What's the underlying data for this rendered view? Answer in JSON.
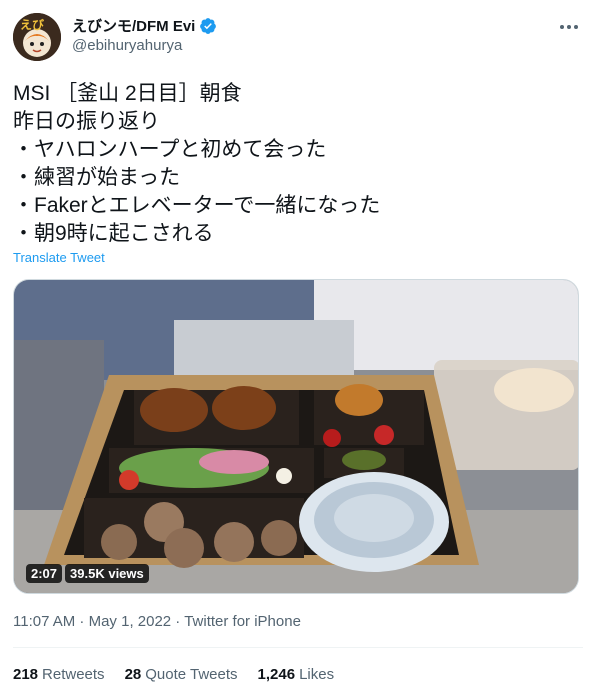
{
  "author": {
    "display_name": "えびンモ/DFM Evi",
    "handle": "@ebihuryahurya",
    "avatar_text": "えび"
  },
  "tweet": {
    "lines": [
      "MSI ［釜山 2日目］朝食",
      "昨日の振り返り",
      "・ヤハロンハープと初めて会った",
      "・練習が始まった",
      "・Fakerとエレベーターで一緒になった",
      "・朝9時に起こされる"
    ],
    "translate_label": "Translate Tweet",
    "video_duration": "2:07",
    "video_views": "39.5K views",
    "timestamp": "11:07 AM · May 1, 2022 · Twitter for iPhone"
  },
  "stats": {
    "retweets_count": "218",
    "retweets_label": "Retweets",
    "quotes_count": "28",
    "quotes_label": "Quote Tweets",
    "likes_count": "1,246",
    "likes_label": "Likes"
  },
  "colors": {
    "accent": "#1d9bf0",
    "secondary_text": "#536471",
    "primary_text": "#0f1419"
  },
  "icons": [
    "verified-badge-icon",
    "more-options-icon"
  ]
}
